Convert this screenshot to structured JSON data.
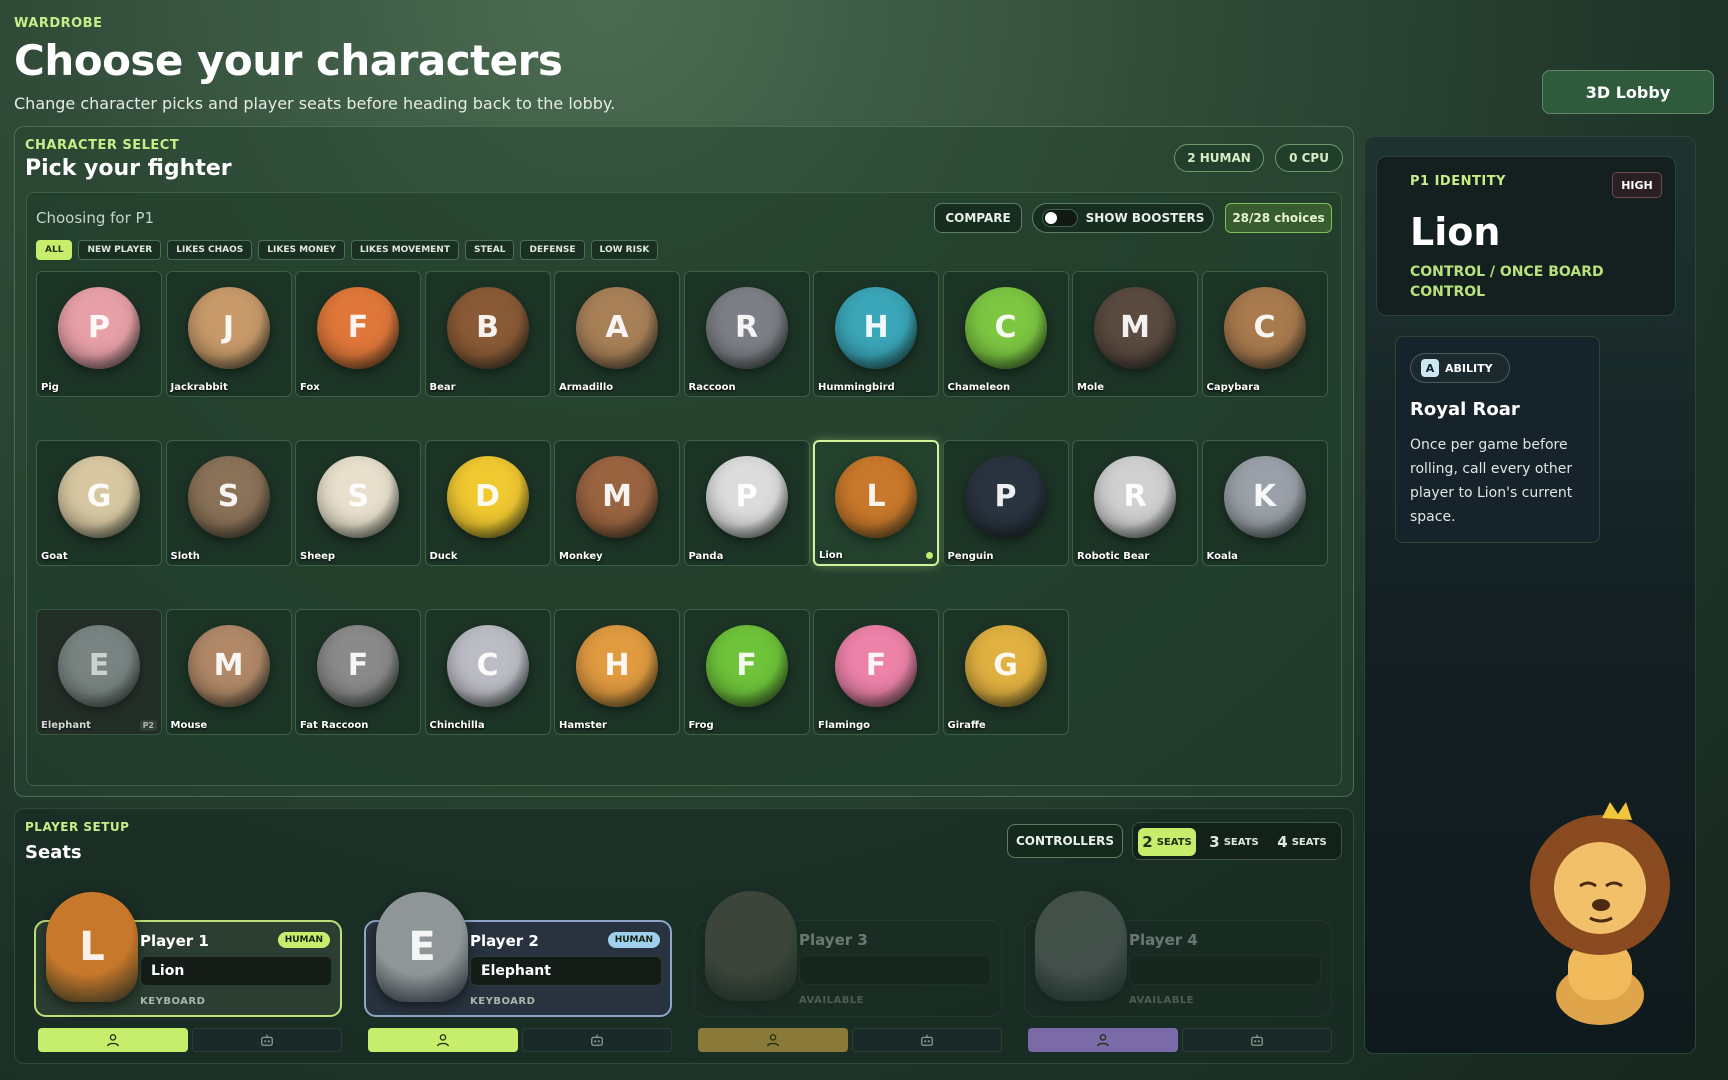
{
  "header": {
    "eyebrow": "WARDROBE",
    "title": "Choose your characters",
    "subtitle": "Change character picks and player seats before heading back to the lobby.",
    "lobby_button": "3D Lobby"
  },
  "character_select": {
    "eyebrow": "CHARACTER SELECT",
    "title": "Pick your fighter",
    "human_pill": "2 HUMAN",
    "cpu_pill": "0 CPU",
    "choosing_label": "Choosing for P1",
    "compare_button": "COMPARE",
    "boosters_toggle": "SHOW BOOSTERS",
    "choices_count": "28/28 choices",
    "filters": [
      "ALL",
      "NEW PLAYER",
      "LIKES CHAOS",
      "LIKES MONEY",
      "LIKES MOVEMENT",
      "STEAL",
      "DEFENSE",
      "LOW RISK"
    ],
    "active_filter": "ALL",
    "characters": [
      {
        "name": "Pig",
        "color": "#e8a0a8",
        "icon": "pig-icon"
      },
      {
        "name": "Jackrabbit",
        "color": "#c89a6a",
        "icon": "jackrabbit-icon"
      },
      {
        "name": "Fox",
        "color": "#e0773a",
        "icon": "fox-icon"
      },
      {
        "name": "Bear",
        "color": "#8a5a36",
        "icon": "bear-icon"
      },
      {
        "name": "Armadillo",
        "color": "#a88058",
        "icon": "armadillo-icon"
      },
      {
        "name": "Raccoon",
        "color": "#7c7f86",
        "icon": "raccoon-icon"
      },
      {
        "name": "Hummingbird",
        "color": "#3aa6b8",
        "icon": "hummingbird-icon"
      },
      {
        "name": "Chameleon",
        "color": "#7cc642",
        "icon": "chameleon-icon"
      },
      {
        "name": "Mole",
        "color": "#5a4a40",
        "icon": "mole-icon"
      },
      {
        "name": "Capybara",
        "color": "#a87a4e",
        "icon": "capybara-icon"
      },
      {
        "name": "Goat",
        "color": "#d8c8a2",
        "icon": "goat-icon"
      },
      {
        "name": "Sloth",
        "color": "#8a7258",
        "icon": "sloth-icon"
      },
      {
        "name": "Sheep",
        "color": "#e8e0cc",
        "icon": "sheep-icon"
      },
      {
        "name": "Duck",
        "color": "#f0c830",
        "icon": "duck-icon"
      },
      {
        "name": "Monkey",
        "color": "#9a6440",
        "icon": "monkey-icon"
      },
      {
        "name": "Panda",
        "color": "#dcdcdc",
        "icon": "panda-icon"
      },
      {
        "name": "Lion",
        "color": "#c8782a",
        "icon": "lion-icon",
        "selected": true
      },
      {
        "name": "Penguin",
        "color": "#2a3440",
        "icon": "penguin-icon"
      },
      {
        "name": "Robotic Bear",
        "color": "#d0d0d0",
        "icon": "robotic-bear-icon"
      },
      {
        "name": "Koala",
        "color": "#9aa0a8",
        "icon": "koala-icon"
      },
      {
        "name": "Elephant",
        "color": "#8f9698",
        "icon": "elephant-icon",
        "taken_by": "P2"
      },
      {
        "name": "Mouse",
        "color": "#b08868",
        "icon": "mouse-icon"
      },
      {
        "name": "Fat Raccoon",
        "color": "#8a8a8a",
        "icon": "fat-raccoon-icon"
      },
      {
        "name": "Chinchilla",
        "color": "#bcbcc4",
        "icon": "chinchilla-icon"
      },
      {
        "name": "Hamster",
        "color": "#e09a40",
        "icon": "hamster-icon"
      },
      {
        "name": "Frog",
        "color": "#6ec33a",
        "icon": "frog-icon"
      },
      {
        "name": "Flamingo",
        "color": "#ec82a8",
        "icon": "flamingo-icon"
      },
      {
        "name": "Giraffe",
        "color": "#e0b040",
        "icon": "giraffe-icon"
      }
    ]
  },
  "player_setup": {
    "eyebrow": "PLAYER SETUP",
    "title": "Seats",
    "controllers_button": "CONTROLLERS",
    "seat_options": [
      {
        "num": "2",
        "label": "SEATS",
        "active": true
      },
      {
        "num": "3",
        "label": "SEATS"
      },
      {
        "num": "4",
        "label": "SEATS"
      }
    ],
    "seats": [
      {
        "player": "Player 1",
        "badge": "HUMAN",
        "character": "Lion",
        "input": "KEYBOARD",
        "color": "#c8782a",
        "accent": "#c6ee6c"
      },
      {
        "player": "Player 2",
        "badge": "HUMAN",
        "character": "Elephant",
        "input": "KEYBOARD",
        "color": "#8f9698",
        "accent": "#c6ee6c"
      },
      {
        "player": "Player 3",
        "badge": "",
        "character": "",
        "input": "AVAILABLE",
        "color": "#7a7060",
        "accent": "#8a7a3a"
      },
      {
        "player": "Player 4",
        "badge": "",
        "character": "",
        "input": "AVAILABLE",
        "color": "#909090",
        "accent": "#7a6aa8"
      }
    ]
  },
  "identity": {
    "eyebrow": "P1 IDENTITY",
    "level": "HIGH",
    "name": "Lion",
    "role": "CONTROL / ONCE BOARD CONTROL",
    "ability_chip": "ABILITY",
    "ability_key": "A",
    "ability_name": "Royal Roar",
    "ability_desc": "Once per game before rolling, call every other player to Lion's current space."
  }
}
